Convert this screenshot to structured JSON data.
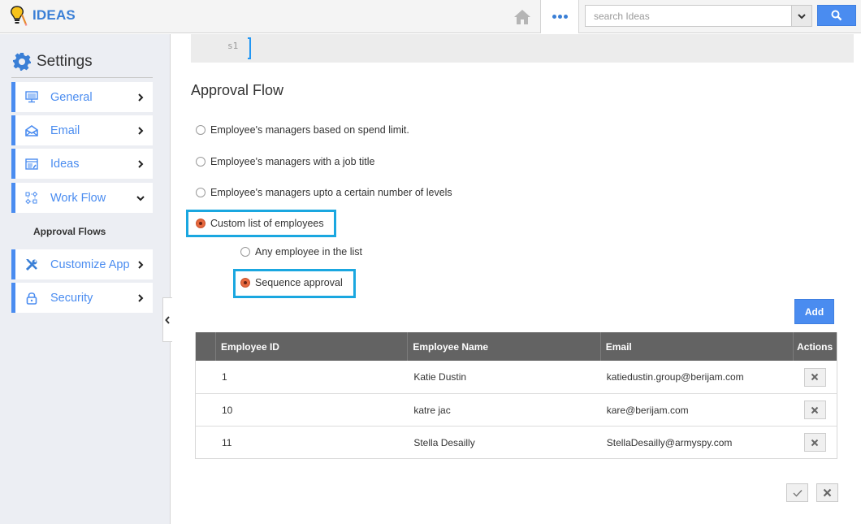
{
  "header": {
    "app_name": "IDEAS",
    "search_placeholder": "search Ideas",
    "search_value": "",
    "icons": {
      "logo": "lightbulb-pencil-icon",
      "home": "home-icon",
      "more": "more-dots-icon",
      "caret": "chevron-down-icon",
      "search": "search-icon"
    }
  },
  "sidebar": {
    "title": "Settings",
    "title_icon": "gear-icon",
    "items": [
      {
        "label": "General",
        "icon": "monitor-icon",
        "state": "collapsed"
      },
      {
        "label": "Email",
        "icon": "envelope-open-icon",
        "state": "collapsed"
      },
      {
        "label": "Ideas",
        "icon": "window-edit-icon",
        "state": "collapsed"
      },
      {
        "label": "Work Flow",
        "icon": "workflow-icon",
        "state": "expanded"
      },
      {
        "label": "Customize App",
        "icon": "tools-icon",
        "state": "collapsed"
      },
      {
        "label": "Security",
        "icon": "lock-icon",
        "state": "collapsed"
      }
    ],
    "subitems": [
      {
        "label": "Approval Flows",
        "parent": "Work Flow",
        "active": true
      }
    ]
  },
  "code_strip": {
    "line_number": "s1"
  },
  "main": {
    "title": "Approval Flow",
    "options": [
      {
        "label": "Employee's managers based on spend limit.",
        "checked": false
      },
      {
        "label": "Employee's managers with a job title",
        "checked": false
      },
      {
        "label": "Employee's managers upto a certain number of levels",
        "checked": false
      },
      {
        "label": "Custom list of employees",
        "checked": true
      }
    ],
    "sub_options": [
      {
        "label": "Any employee in the list",
        "checked": false
      },
      {
        "label": "Sequence approval",
        "checked": true
      }
    ],
    "add_label": "Add",
    "table": {
      "columns": [
        "",
        "Employee ID",
        "Employee Name",
        "Email",
        "Actions"
      ],
      "rows": [
        {
          "id": "1",
          "name": "Katie Dustin",
          "email": "katiedustin.group@berijam.com"
        },
        {
          "id": "10",
          "name": "katre jac",
          "email": "kare@berijam.com"
        },
        {
          "id": "11",
          "name": "Stella Desailly",
          "email": "StellaDesailly@armyspy.com"
        }
      ]
    },
    "footer": {
      "save_icon": "check-icon",
      "cancel_icon": "close-icon"
    }
  },
  "colors": {
    "accent": "#4a8cf0",
    "highlight": "#1aa7e0",
    "radio_checked": "#e7693f",
    "table_header": "#636363"
  }
}
